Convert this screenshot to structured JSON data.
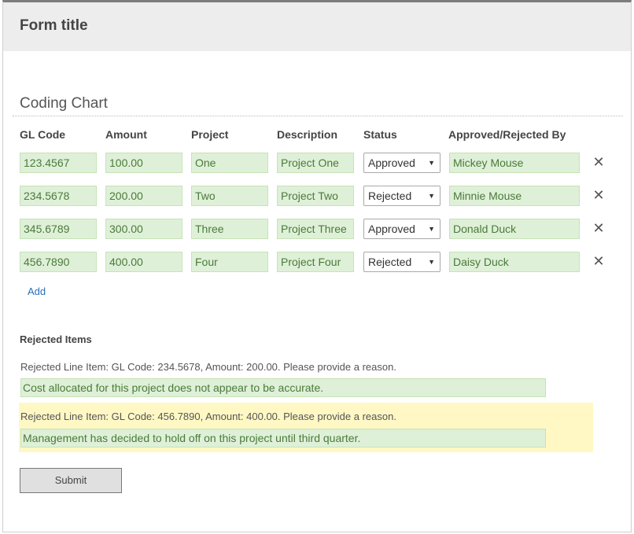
{
  "form": {
    "title": "Form title"
  },
  "coding_chart": {
    "title": "Coding Chart",
    "columns": [
      "GL Code",
      "Amount",
      "Project",
      "Description",
      "Status",
      "Approved/Rejected By"
    ],
    "rows": [
      {
        "gl_code": "123.4567",
        "amount": "100.00",
        "project": "One",
        "description": "Project One",
        "status": "Approved",
        "by": "Mickey Mouse"
      },
      {
        "gl_code": "234.5678",
        "amount": "200.00",
        "project": "Two",
        "description": "Project Two",
        "status": "Rejected",
        "by": "Minnie Mouse"
      },
      {
        "gl_code": "345.6789",
        "amount": "300.00",
        "project": "Three",
        "description": "Project Three",
        "status": "Approved",
        "by": "Donald Duck"
      },
      {
        "gl_code": "456.7890",
        "amount": "400.00",
        "project": "Four",
        "description": "Project Four",
        "status": "Rejected",
        "by": "Daisy Duck"
      }
    ],
    "remove_symbol": "✕",
    "caret_symbol": "▼",
    "add_label": "Add"
  },
  "rejected": {
    "title": "Rejected Items",
    "items": [
      {
        "text": "Rejected Line Item: GL Code: 234.5678, Amount: 200.00. Please provide a reason.",
        "reason": "Cost allocated for this project does not appear to be accurate."
      },
      {
        "text": "Rejected Line Item: GL Code: 456.7890, Amount: 400.00. Please provide a reason.",
        "reason": "Management has decided to hold off on this project until third quarter."
      }
    ]
  },
  "submit_label": "Submit",
  "colors": {
    "field_bg": "#dff0d8",
    "field_text": "#4a7a3a",
    "highlight_bg": "#fff8c4",
    "link": "#2a6ebb",
    "header_bg": "#ededed"
  }
}
